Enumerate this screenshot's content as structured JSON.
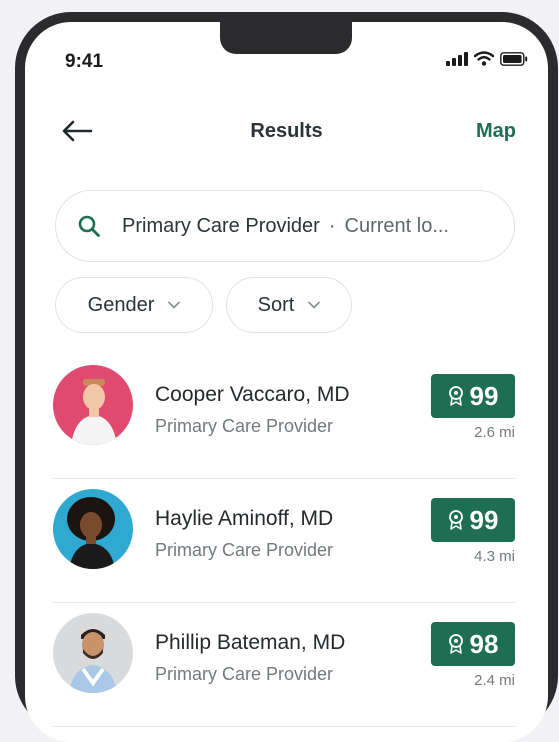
{
  "status_bar": {
    "time": "9:41"
  },
  "nav": {
    "title": "Results",
    "map_label": "Map"
  },
  "search": {
    "query": "Primary Care Provider",
    "separator": "·",
    "location": "Current lo..."
  },
  "filters": [
    {
      "label": "Gender"
    },
    {
      "label": "Sort"
    }
  ],
  "results": [
    {
      "name": "Cooper Vaccaro, MD",
      "specialty": "Primary Care Provider",
      "score": "99",
      "distance": "2.6 mi",
      "avatar_bg": "#e04a6e"
    },
    {
      "name": "Haylie Aminoff, MD",
      "specialty": "Primary Care Provider",
      "score": "99",
      "distance": "4.3 mi",
      "avatar_bg": "#2fa9d1"
    },
    {
      "name": "Phillip Bateman, MD",
      "specialty": "Primary Care Provider",
      "score": "98",
      "distance": "2.4 mi",
      "avatar_bg": "#d9dadc"
    }
  ],
  "colors": {
    "accent": "#1e6e54",
    "frame": "#2b2b2d"
  }
}
